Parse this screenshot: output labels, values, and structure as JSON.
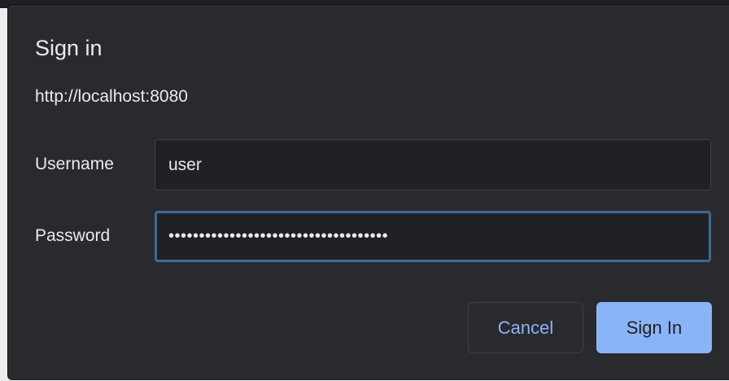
{
  "dialog": {
    "title": "Sign in",
    "origin": "http://localhost:8080",
    "username_label": "Username",
    "username_value": "user",
    "password_label": "Password",
    "password_masked": "••••••••••••••••••••••••••••••••••••",
    "cancel_label": "Cancel",
    "signin_label": "Sign In"
  },
  "colors": {
    "accent": "#8ab4f8",
    "background": "#292a2d",
    "input_bg": "#202124",
    "focus_border": "#3e6a94"
  }
}
